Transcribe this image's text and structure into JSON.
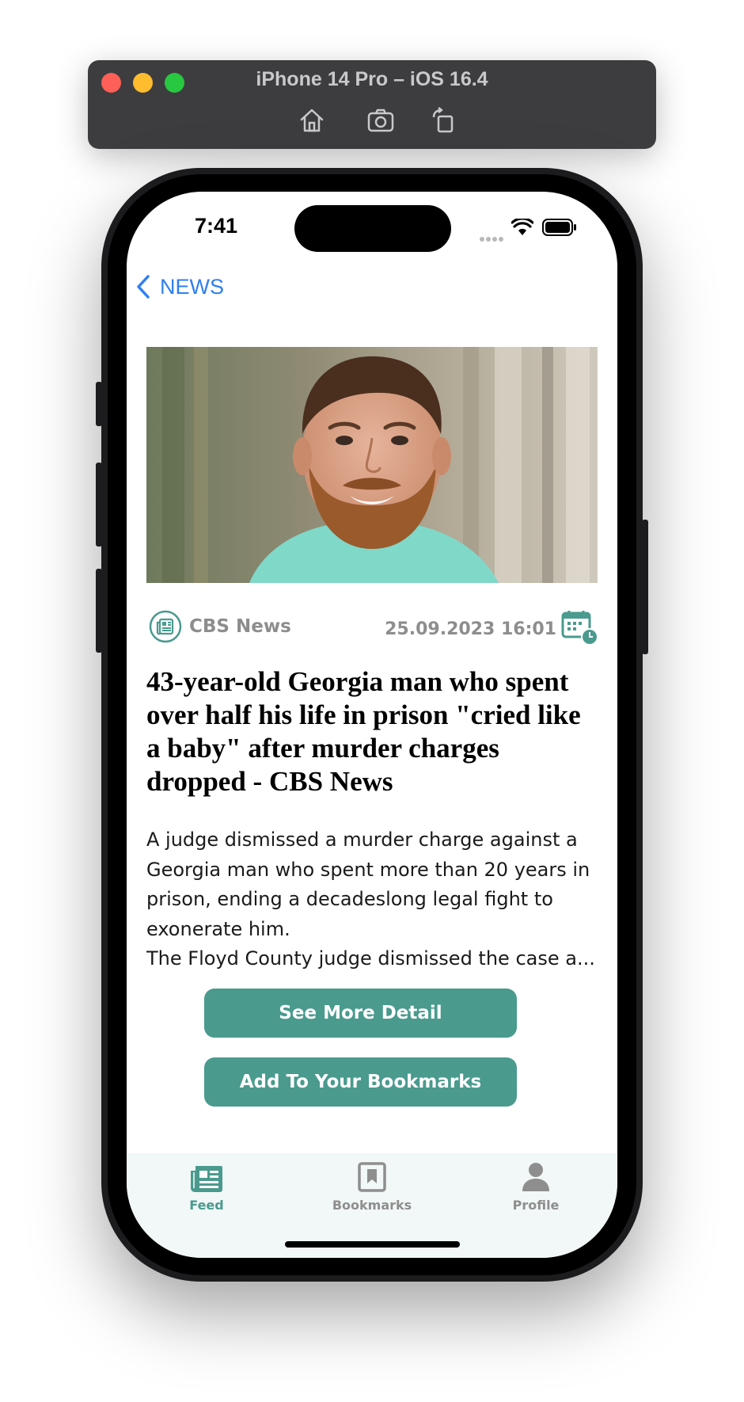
{
  "simulator": {
    "title": "iPhone 14 Pro – iOS 16.4",
    "buttons": [
      "home-icon",
      "screenshot-icon",
      "rotate-icon"
    ]
  },
  "status_bar": {
    "time": "7:41"
  },
  "nav": {
    "back_label": "NEWS"
  },
  "article": {
    "image": "portrait photo of a bearded man",
    "source": "CBS News",
    "date": "25.09.2023 16:01",
    "headline": "43-year-old Georgia man who spent over half his life in prison \"cried like a baby\" after murder charges dropped - CBS News",
    "summary_line1": "A judge dismissed a murder charge against a Georgia man who spent more than 20 years in prison, ending a decadeslong legal fight to exonerate him.",
    "summary_line2": "The Floyd County judge dismissed the case a..."
  },
  "actions": {
    "detail_label": "See More Detail",
    "bookmark_label": "Add To Your Bookmarks"
  },
  "tabbar": {
    "items": [
      {
        "label": "Feed",
        "icon": "newspaper-icon",
        "active": true
      },
      {
        "label": "Bookmarks",
        "icon": "bookmark-icon",
        "active": false
      },
      {
        "label": "Profile",
        "icon": "person-icon",
        "active": false
      }
    ]
  },
  "colors": {
    "accent": "#4a9a8e",
    "link": "#2f7ff0",
    "muted": "#8d8d8d",
    "tab_inactive": "#8e8e8e",
    "tabbar_bg": "#f1f8f7"
  }
}
